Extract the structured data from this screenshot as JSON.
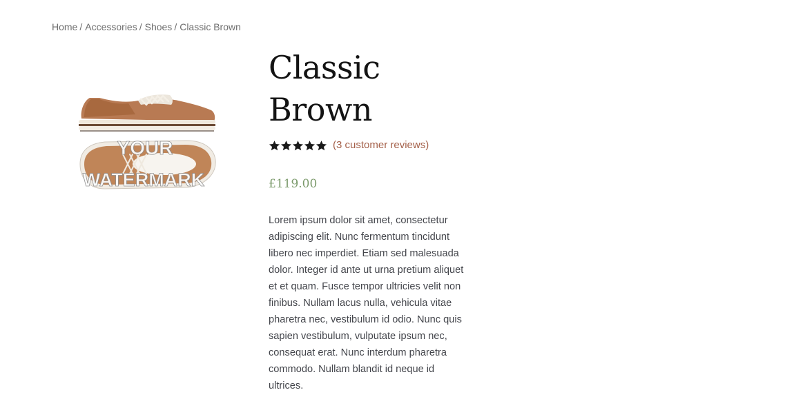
{
  "breadcrumb": {
    "items": [
      "Home",
      "Accessories",
      "Shoes"
    ],
    "separator": "/",
    "current": "Classic Brown"
  },
  "product": {
    "title_line1": "Classic",
    "title_line2": "Brown",
    "rating": 5,
    "rating_max": 5,
    "reviews_label": "(3 customer reviews)",
    "price": "£119.00",
    "description": "Lorem ipsum dolor sit amet, consectetur adipiscing elit. Nunc fermentum tincidunt libero nec imperdiet. Etiam sed malesuada dolor. Integer id ante ut urna pretium aliquet et et quam. Fusce tempor ultricies velit non finibus. Nullam lacus nulla, vehicula vitae pharetra nec, vestibulum id odio. Nunc quis sapien vestibulum, vulputate ipsum nec, consequat erat. Nunc interdum pharetra commodo. Nullam blandit id neque id ultrices.",
    "image_watermark_line1": "YOUR",
    "image_watermark_line2": "WATERMARK"
  },
  "colors": {
    "accent_link": "#a46049",
    "price": "#7b9a6b",
    "title": "#131313",
    "star": "#1a1a1a"
  },
  "icons": {
    "star": "star-icon"
  }
}
